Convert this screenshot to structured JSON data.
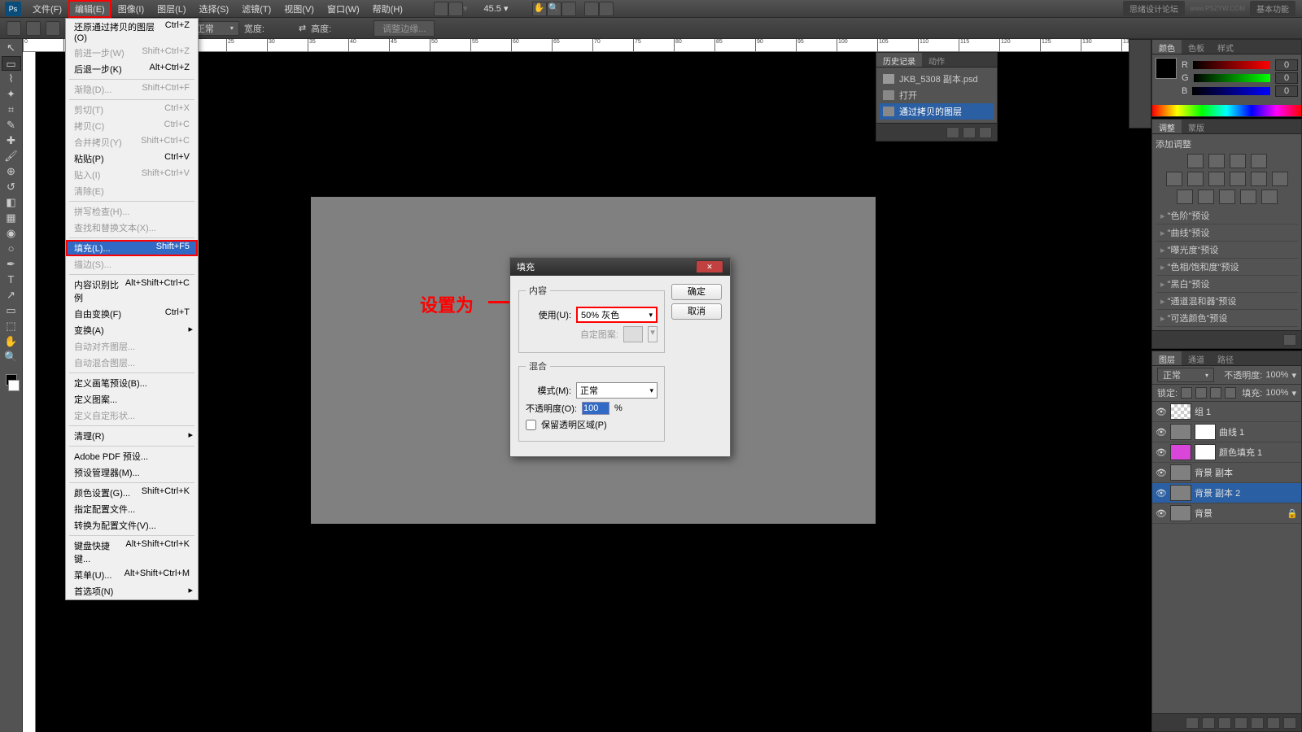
{
  "menubar": {
    "items": [
      "文件(F)",
      "编辑(E)",
      "图像(I)",
      "图层(L)",
      "选择(S)",
      "滤镜(T)",
      "视图(V)",
      "窗口(W)",
      "帮助(H)"
    ],
    "active_index": 1,
    "zoom": "45.5",
    "right_badges": [
      "思绪设计论坛",
      "基本功能"
    ]
  },
  "options_bar": {
    "mode_label": "正常",
    "opts": [
      "调整边缘..."
    ]
  },
  "edit_menu": [
    {
      "label": "还原通过拷贝的图层(O)",
      "sc": "Ctrl+Z"
    },
    {
      "label": "前进一步(W)",
      "sc": "Shift+Ctrl+Z",
      "disabled": true
    },
    {
      "label": "后退一步(K)",
      "sc": "Alt+Ctrl+Z"
    },
    {
      "sep": true
    },
    {
      "label": "渐隐(D)...",
      "sc": "Shift+Ctrl+F",
      "disabled": true
    },
    {
      "sep": true
    },
    {
      "label": "剪切(T)",
      "sc": "Ctrl+X",
      "disabled": true
    },
    {
      "label": "拷贝(C)",
      "sc": "Ctrl+C",
      "disabled": true
    },
    {
      "label": "合并拷贝(Y)",
      "sc": "Shift+Ctrl+C",
      "disabled": true
    },
    {
      "label": "粘贴(P)",
      "sc": "Ctrl+V"
    },
    {
      "label": "贴入(I)",
      "sc": "Shift+Ctrl+V",
      "disabled": true
    },
    {
      "label": "清除(E)",
      "disabled": true
    },
    {
      "sep": true
    },
    {
      "label": "拼写检查(H)...",
      "disabled": true
    },
    {
      "label": "查找和替换文本(X)...",
      "disabled": true
    },
    {
      "sep": true
    },
    {
      "label": "填充(L)...",
      "sc": "Shift+F5",
      "hl": true
    },
    {
      "label": "描边(S)...",
      "disabled": true
    },
    {
      "sep": true
    },
    {
      "label": "内容识别比例",
      "sc": "Alt+Shift+Ctrl+C"
    },
    {
      "label": "自由变换(F)",
      "sc": "Ctrl+T"
    },
    {
      "label": "变换(A)",
      "sub": true
    },
    {
      "label": "自动对齐图层...",
      "disabled": true
    },
    {
      "label": "自动混合图层...",
      "disabled": true
    },
    {
      "sep": true
    },
    {
      "label": "定义画笔预设(B)..."
    },
    {
      "label": "定义图案..."
    },
    {
      "label": "定义自定形状...",
      "disabled": true
    },
    {
      "sep": true
    },
    {
      "label": "清理(R)",
      "sub": true
    },
    {
      "sep": true
    },
    {
      "label": "Adobe PDF 预设..."
    },
    {
      "label": "预设管理器(M)..."
    },
    {
      "sep": true
    },
    {
      "label": "颜色设置(G)...",
      "sc": "Shift+Ctrl+K"
    },
    {
      "label": "指定配置文件..."
    },
    {
      "label": "转换为配置文件(V)..."
    },
    {
      "sep": true
    },
    {
      "label": "键盘快捷键...",
      "sc": "Alt+Shift+Ctrl+K"
    },
    {
      "label": "菜单(U)...",
      "sc": "Alt+Shift+Ctrl+M"
    },
    {
      "label": "首选项(N)",
      "sub": true
    }
  ],
  "dialog": {
    "title": "填充",
    "section1": "内容",
    "use_label": "使用(U):",
    "use_value": "50% 灰色",
    "pattern_label": "自定图案:",
    "section2": "混合",
    "mode_label": "模式(M):",
    "mode_value": "正常",
    "opacity_label": "不透明度(O):",
    "opacity_value": "100",
    "opacity_unit": "%",
    "preserve": "保留透明区域(P)",
    "ok": "确定",
    "cancel": "取消"
  },
  "annotation": "设置为",
  "history": {
    "tabs": [
      "历史记录",
      "动作"
    ],
    "file": "JKB_5308 副本.psd",
    "items": [
      "打开",
      "通过拷贝的图层"
    ]
  },
  "color": {
    "tabs": [
      "颜色",
      "色板",
      "样式"
    ],
    "r": "0",
    "g": "0",
    "b": "0",
    "labels": [
      "R",
      "G",
      "B"
    ]
  },
  "adjust": {
    "tabs": [
      "调整",
      "蒙版"
    ],
    "title": "添加调整",
    "presets": [
      "\"色阶\"预设",
      "\"曲线\"预设",
      "\"曝光度\"预设",
      "\"色相/饱和度\"预设",
      "\"黑白\"预设",
      "\"通道混和器\"预设",
      "\"可选颜色\"预设"
    ]
  },
  "layers": {
    "tabs": [
      "图层",
      "通道",
      "路径"
    ],
    "mode": "正常",
    "opacity_label": "不透明度:",
    "opacity": "100%",
    "lock_label": "锁定:",
    "fill_label": "填充:",
    "fill": "100%",
    "items": [
      {
        "name": "组 1",
        "thumb": "checker"
      },
      {
        "name": "曲线 1",
        "thumb": "adj",
        "mask": true
      },
      {
        "name": "颜色填充 1",
        "thumb": "magenta",
        "mask": true
      },
      {
        "name": "背景 副本",
        "thumb": "gray"
      },
      {
        "name": "背景 副本 2",
        "thumb": "gray",
        "active": true
      },
      {
        "name": "背景",
        "thumb": "gray",
        "locked": true
      }
    ]
  }
}
